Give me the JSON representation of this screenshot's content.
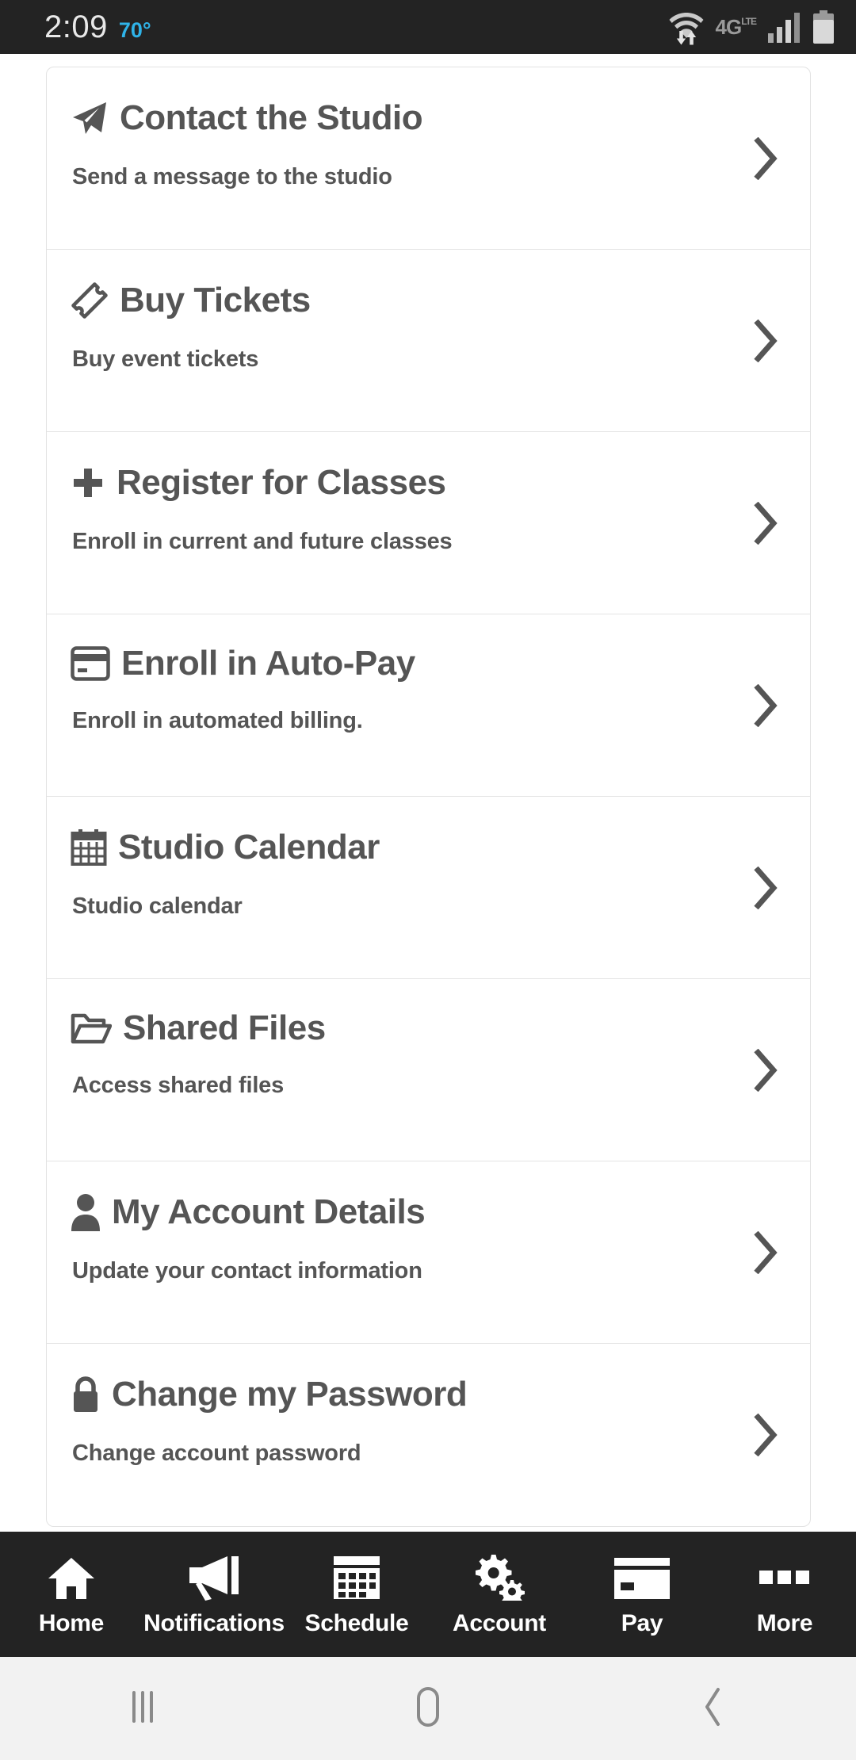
{
  "status_bar": {
    "time": "2:09",
    "temperature": "70°",
    "network_label": "4G",
    "network_sup": "LTE",
    "icons": [
      "wifi-data-icon",
      "network-4glte-icon",
      "signal-bars-icon",
      "battery-icon"
    ],
    "colors": {
      "background": "#232323",
      "time": "#e8e8e8",
      "temperature": "#2fb3e8",
      "icon": "#b9b9b9"
    }
  },
  "menu": {
    "items": [
      {
        "icon": "paper-plane-icon",
        "title": "Contact the Studio",
        "subtitle": "Send a message to the studio",
        "chevron": "chevron-right-icon"
      },
      {
        "icon": "ticket-icon",
        "title": "Buy Tickets",
        "subtitle": "Buy event tickets",
        "chevron": "chevron-right-icon"
      },
      {
        "icon": "plus-icon",
        "title": "Register for Classes",
        "subtitle": "Enroll in current and future classes",
        "chevron": "chevron-right-icon"
      },
      {
        "icon": "credit-card-icon",
        "title": "Enroll in Auto-Pay",
        "subtitle": "Enroll in automated billing.",
        "chevron": "chevron-right-icon"
      },
      {
        "icon": "calendar-icon",
        "title": "Studio Calendar",
        "subtitle": "Studio calendar",
        "chevron": "chevron-right-icon"
      },
      {
        "icon": "folder-open-icon",
        "title": "Shared Files",
        "subtitle": "Access shared files",
        "chevron": "chevron-right-icon"
      },
      {
        "icon": "user-icon",
        "title": "My Account Details",
        "subtitle": "Update your contact information",
        "chevron": "chevron-right-icon"
      },
      {
        "icon": "lock-icon",
        "title": "Change my Password",
        "subtitle": "Change account password",
        "chevron": "chevron-right-icon"
      }
    ],
    "colors": {
      "text": "#555555",
      "card_background": "#ffffff",
      "border": "#e2e2e2",
      "divider": "#e4e4e4"
    }
  },
  "tab_bar": {
    "tabs": [
      {
        "icon": "home-icon",
        "label": "Home"
      },
      {
        "icon": "megaphone-icon",
        "label": "Notifications"
      },
      {
        "icon": "calendar-icon",
        "label": "Schedule"
      },
      {
        "icon": "gears-icon",
        "label": "Account"
      },
      {
        "icon": "credit-card-icon",
        "label": "Pay"
      },
      {
        "icon": "ellipsis-squares-icon",
        "label": "More"
      }
    ],
    "colors": {
      "background": "#232323",
      "foreground": "#ffffff"
    }
  },
  "nav_bar": {
    "buttons": [
      {
        "icon": "recents-icon",
        "name": "recent-apps"
      },
      {
        "icon": "home-square-icon",
        "name": "home"
      },
      {
        "icon": "back-chevron-icon",
        "name": "back"
      }
    ],
    "colors": {
      "background": "#f2f2f2",
      "foreground": "#8a8a8a"
    }
  }
}
